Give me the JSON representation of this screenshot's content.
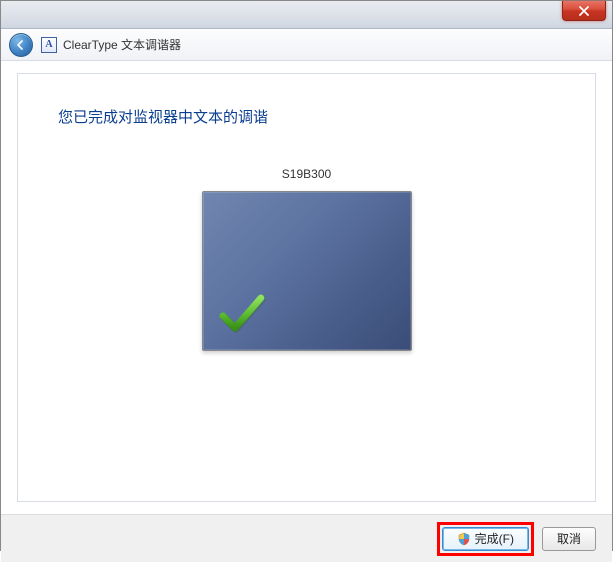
{
  "window": {
    "title": "ClearType 文本调谐器"
  },
  "heading": "您已完成对监视器中文本的调谐",
  "monitor": {
    "name": "S19B300"
  },
  "buttons": {
    "finish": "完成(F)",
    "cancel": "取消"
  }
}
